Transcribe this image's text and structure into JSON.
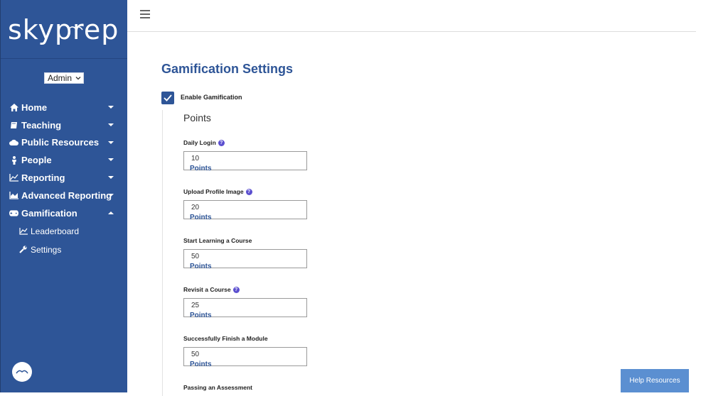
{
  "brand": {
    "logo_text": "skyprep"
  },
  "role_select": {
    "value": "Admin"
  },
  "nav": [
    {
      "label": "Home",
      "icon": "home-icon"
    },
    {
      "label": "Teaching",
      "icon": "book-icon"
    },
    {
      "label": "Public Resources",
      "icon": "cloud-icon"
    },
    {
      "label": "People",
      "icon": "person-icon"
    },
    {
      "label": "Reporting",
      "icon": "line-chart-icon"
    },
    {
      "label": "Advanced Reporting",
      "icon": "area-chart-icon"
    },
    {
      "label": "Gamification",
      "icon": "gamepad-icon"
    }
  ],
  "subnav": [
    {
      "label": "Leaderboard",
      "icon": "line-chart-icon"
    },
    {
      "label": "Settings",
      "icon": "wrench-icon"
    }
  ],
  "main": {
    "title": "Gamification Settings",
    "enable_label": "Enable Gamification",
    "enable_checked": true,
    "section_title": "Points",
    "fields": [
      {
        "label": "Daily Login",
        "help": true,
        "value": "10",
        "unit": "Points"
      },
      {
        "label": "Upload Profile Image",
        "help": true,
        "value": "20",
        "unit": "Points"
      },
      {
        "label": "Start Learning a Course",
        "help": false,
        "value": "50",
        "unit": "Points"
      },
      {
        "label": "Revisit a Course",
        "help": true,
        "value": "25",
        "unit": "Points"
      },
      {
        "label": "Successfully Finish a Module",
        "help": false,
        "value": "50",
        "unit": "Points"
      }
    ],
    "last_label": "Passing an Assessment"
  },
  "help_button": {
    "label": "Help Resources"
  },
  "colors": {
    "sidebar": "#2e5597",
    "accent": "#2e5597",
    "help_button": "#5b8fd1",
    "help_icon": "#5b4fcf"
  }
}
